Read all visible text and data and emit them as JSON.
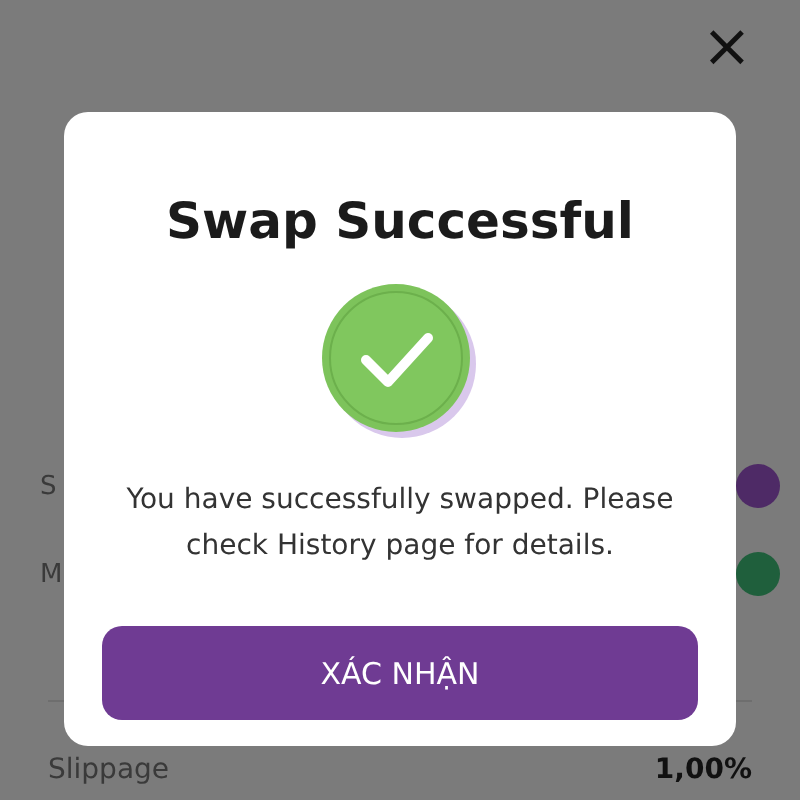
{
  "background": {
    "close": "×",
    "rows": [
      {
        "label": "S",
        "color": "#4e2a66"
      },
      {
        "label": "M",
        "color": "#1f5f3c"
      }
    ],
    "slippage": {
      "label": "Slippage",
      "value": "1,00%"
    }
  },
  "dialog": {
    "title": "Swap Successful",
    "message": "You have successfully swapped. Please check History page for details.",
    "button": "XÁC NHẬN"
  }
}
